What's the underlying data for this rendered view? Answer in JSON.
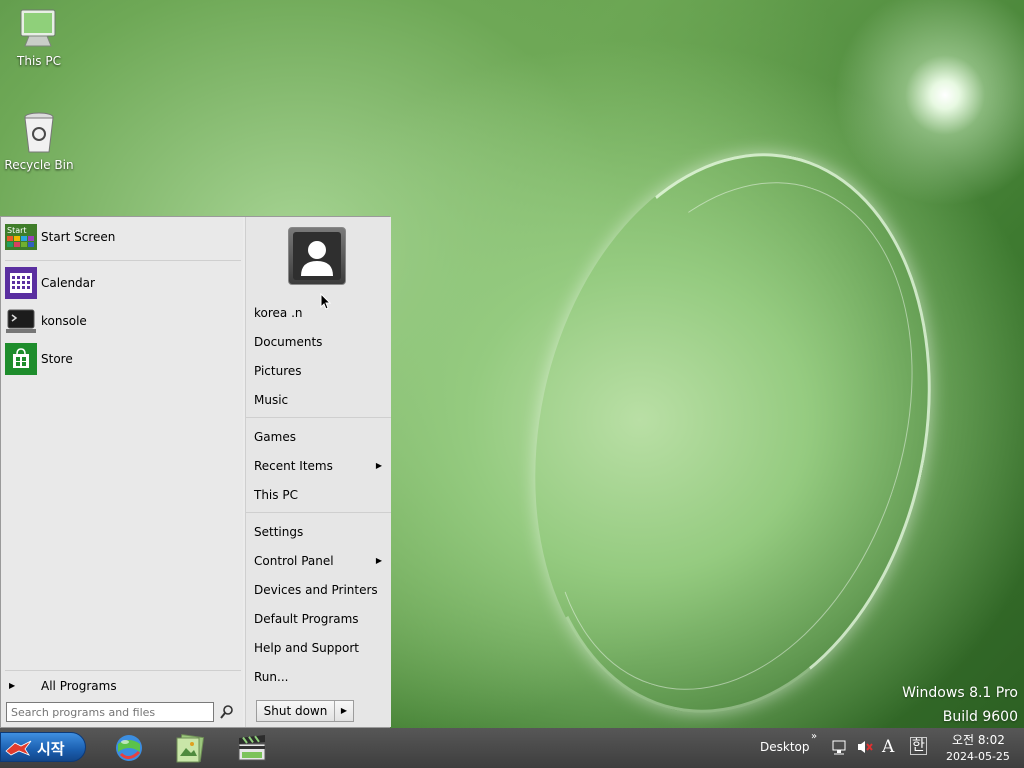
{
  "desktop": {
    "icons": [
      {
        "label": "This PC"
      },
      {
        "label": "Recycle Bin"
      }
    ],
    "watermark": {
      "line1": "Windows 8.1 Pro",
      "line2": "Build 9600"
    }
  },
  "start_menu": {
    "pinned": [
      {
        "label": "Start Screen",
        "icon": "start-screen-icon"
      },
      {
        "label": "Calendar",
        "icon": "calendar-icon"
      },
      {
        "label": "konsole",
        "icon": "terminal-icon"
      },
      {
        "label": "Store",
        "icon": "store-icon"
      }
    ],
    "start_tile_text": "Start",
    "all_programs": "All Programs",
    "search_placeholder": "Search programs and files",
    "user": "korea .n",
    "right_items": [
      {
        "label": "Documents"
      },
      {
        "label": "Pictures"
      },
      {
        "label": "Music"
      },
      {
        "label": "Games"
      },
      {
        "label": "Recent Items",
        "submenu": true
      },
      {
        "label": "This PC"
      },
      {
        "label": "Settings"
      },
      {
        "label": "Control Panel",
        "submenu": true
      },
      {
        "label": "Devices and Printers"
      },
      {
        "label": "Default Programs"
      },
      {
        "label": "Help and Support"
      },
      {
        "label": "Run..."
      }
    ],
    "shutdown_label": "Shut down"
  },
  "taskbar": {
    "start_label": "시작",
    "desktop_label": "Desktop",
    "ime_label": "A",
    "lang_label": "한",
    "clock": {
      "time": "오전 8:02",
      "date": "2024-05-25"
    }
  },
  "colors": {
    "taskbar": "#474747",
    "start_button": "#1b5fb0",
    "menu_bg": "#e9e9e9"
  }
}
